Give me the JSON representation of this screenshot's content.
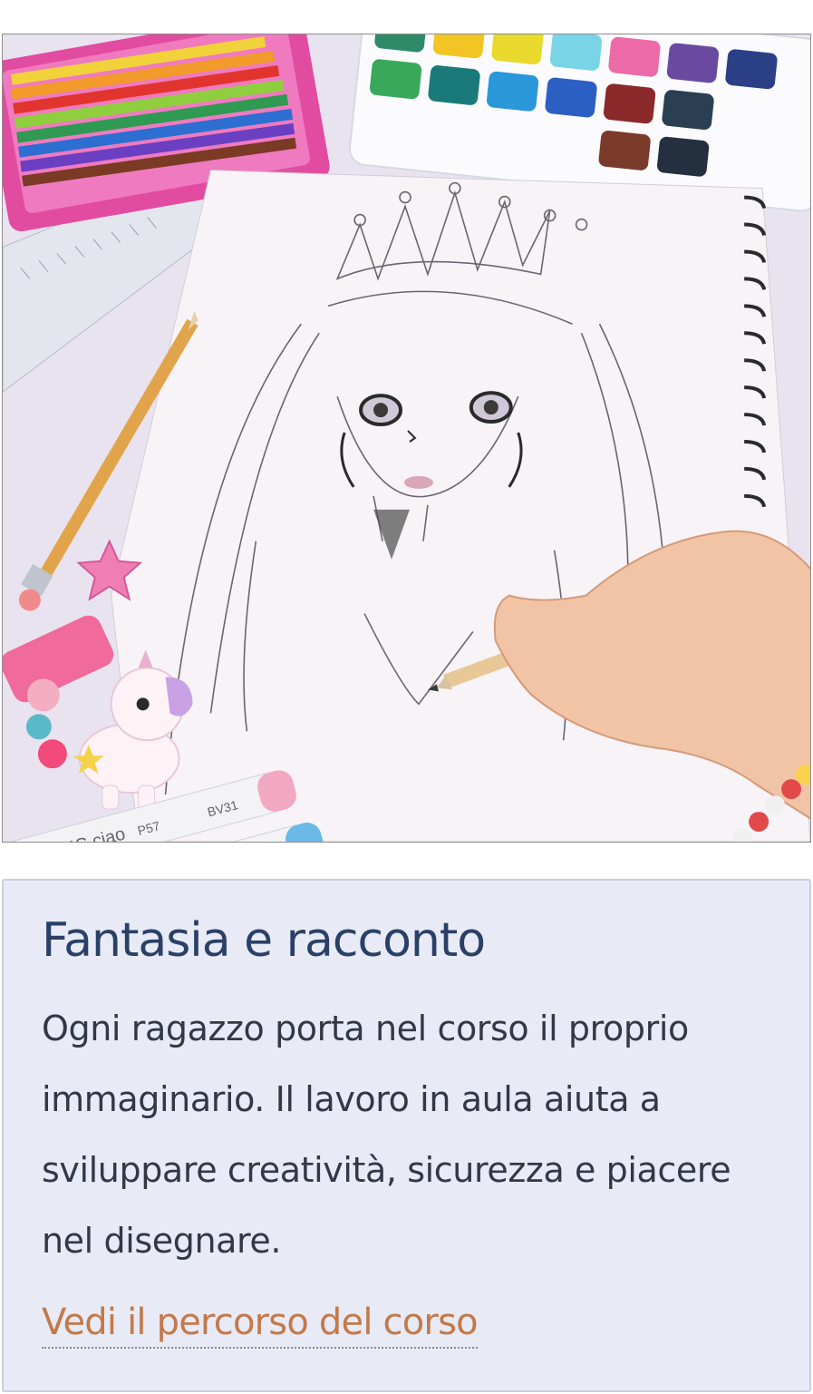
{
  "image": {
    "icon": "drawing-photo",
    "marker_labels": [
      "COPIC ciao",
      "P57",
      "BV31"
    ]
  },
  "card": {
    "title": "Fantasia e racconto",
    "body": "Ogni ragazzo porta nel corso il proprio immaginario. Il lavoro in aula aiuta a sviluppare creatività, sicurezza e piacere nel disegnare.",
    "link_label": "Vedi il percorso del corso"
  },
  "colors": {
    "title": "#2a4066",
    "body_text": "#333846",
    "link": "#c4794a",
    "card_bg": "#e8ebf6",
    "card_border": "#c9cfdf"
  }
}
